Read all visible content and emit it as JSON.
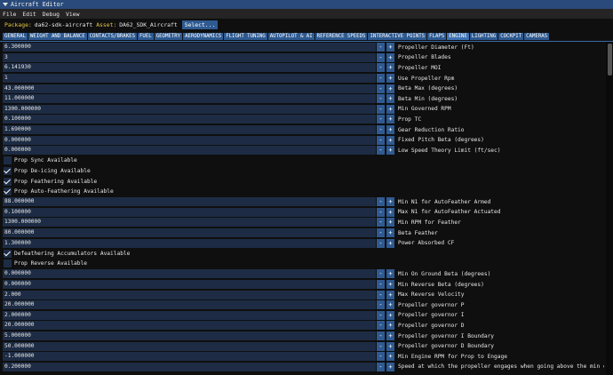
{
  "window": {
    "title": "Aircraft Editor"
  },
  "menu": [
    "File",
    "Edit",
    "Debug",
    "View"
  ],
  "package": {
    "package_label": "Package:",
    "package_value": "da62-sdk-aircraft",
    "asset_label": "Asset:",
    "asset_value": "DA62_SDK_Aircraft",
    "select_label": "Select..."
  },
  "tabs": [
    "GENERAL",
    "WEIGHT AND BALANCE",
    "CONTACTS/BRAKES",
    "FUEL",
    "GEOMETRY",
    "AERODYNAMICS",
    "FLIGHT TUNING",
    "AUTOPILOT & AI",
    "REFERENCE SPEEDS",
    "INTERACTIVE POINTS",
    "FLAPS",
    "ENGINE",
    "LIGHTING",
    "COCKPIT",
    "CAMERAS"
  ],
  "active_tab": "ENGINE",
  "buttons": {
    "minus": "-",
    "plus": "+"
  },
  "rows": [
    {
      "type": "number",
      "value": "6.300000",
      "label": "Propeller Diameter (Ft)"
    },
    {
      "type": "number",
      "value": "3",
      "label": "Propeller Blades"
    },
    {
      "type": "number",
      "value": "6.141930",
      "label": "Propeller MOI"
    },
    {
      "type": "number",
      "value": "1",
      "label": "Use Propeller Rpm"
    },
    {
      "type": "number",
      "value": "43.000000",
      "label": "Beta Max (degrees)"
    },
    {
      "type": "number",
      "value": "11.000000",
      "label": "Beta Min (degrees)"
    },
    {
      "type": "number",
      "value": "1300.000000",
      "label": "Min Governed RPM"
    },
    {
      "type": "number",
      "value": "0.100000",
      "label": "Prop TC"
    },
    {
      "type": "number",
      "value": "1.690000",
      "label": "Gear Reduction Ratio"
    },
    {
      "type": "number",
      "value": "0.000000",
      "label": "Fixed Pitch Beta (degrees)"
    },
    {
      "type": "number",
      "value": "0.000000",
      "label": "Low Speed Theory Limit (ft/sec)"
    },
    {
      "type": "check",
      "checked": false,
      "label": "Prop Sync Available"
    },
    {
      "type": "check",
      "checked": true,
      "label": "Prop De-icing Available"
    },
    {
      "type": "check",
      "checked": true,
      "label": "Prop Feathering Available"
    },
    {
      "type": "check",
      "checked": true,
      "label": "Prop Auto-Feathering Available"
    },
    {
      "type": "number",
      "value": "88.000000",
      "label": "Min N1 for AutoFeather Armed"
    },
    {
      "type": "number",
      "value": "0.100000",
      "label": "Max N1 for AutoFeather Actuated"
    },
    {
      "type": "number",
      "value": "1300.000000",
      "label": "Min RPM for Feather"
    },
    {
      "type": "number",
      "value": "80.000000",
      "label": "Beta Feather"
    },
    {
      "type": "number",
      "value": "1.300000",
      "label": "Power Absorbed CF"
    },
    {
      "type": "check",
      "checked": true,
      "label": "Defeathering Accumulators Available"
    },
    {
      "type": "check",
      "checked": false,
      "label": "Prop Reverse Available"
    },
    {
      "type": "number",
      "value": "0.000000",
      "label": "Min On Ground Beta (degrees)"
    },
    {
      "type": "number",
      "value": "0.000000",
      "label": "Min Reverse Beta (degrees)"
    },
    {
      "type": "number",
      "value": "2.000",
      "label": "Max Reverse Velocity"
    },
    {
      "type": "number",
      "value": "20.000000",
      "label": "Propeller governor P"
    },
    {
      "type": "number",
      "value": "2.000000",
      "label": "Propeller governor I"
    },
    {
      "type": "number",
      "value": "20.000000",
      "label": "Propeller governor D"
    },
    {
      "type": "number",
      "value": "5.000000",
      "label": "Propeller governor I Boundary"
    },
    {
      "type": "number",
      "value": "50.000000",
      "label": "Propeller governor D Boundary"
    },
    {
      "type": "number",
      "value": "-1.000000",
      "label": "Min Engine RPM for Prop to Engage"
    },
    {
      "type": "number",
      "value": "0.200000",
      "label": "Speed at which the propeller engages when going above the min engine rp"
    }
  ]
}
